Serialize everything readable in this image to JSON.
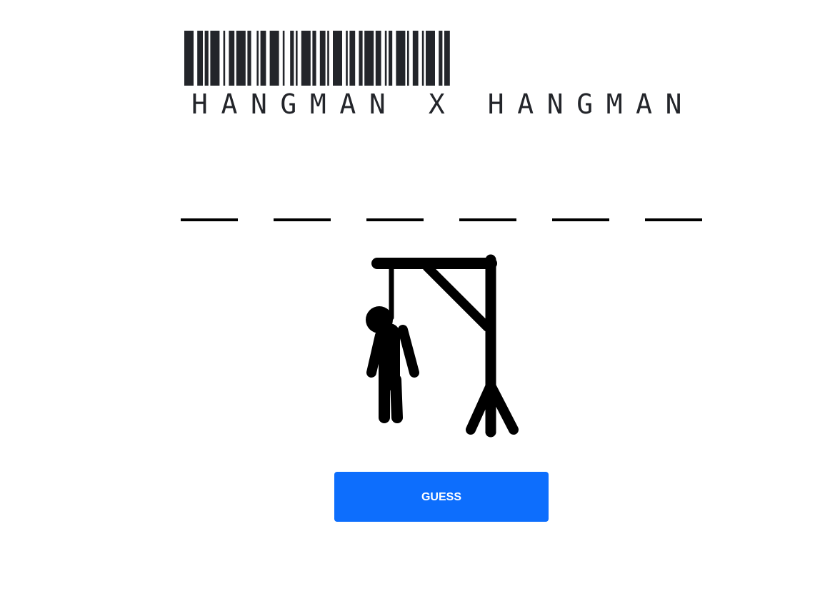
{
  "app": {
    "logo_text": "HANGMAN X HANGMAN"
  },
  "word": {
    "slots": [
      "",
      "",
      "",
      "",
      "",
      ""
    ]
  },
  "hangman": {
    "stage_parts_drawn": [
      "gallows",
      "rope",
      "head",
      "body",
      "left-arm",
      "right-arm",
      "left-leg",
      "right-leg"
    ]
  },
  "actions": {
    "guess_label": "GUESS"
  },
  "colors": {
    "button_bg": "#0d6efd",
    "button_text": "#ffffff",
    "ink": "#000000",
    "logo_ink": "#23252a"
  },
  "icons": {
    "logo": "barcode-icon",
    "figure": "hanged-man-icon"
  }
}
